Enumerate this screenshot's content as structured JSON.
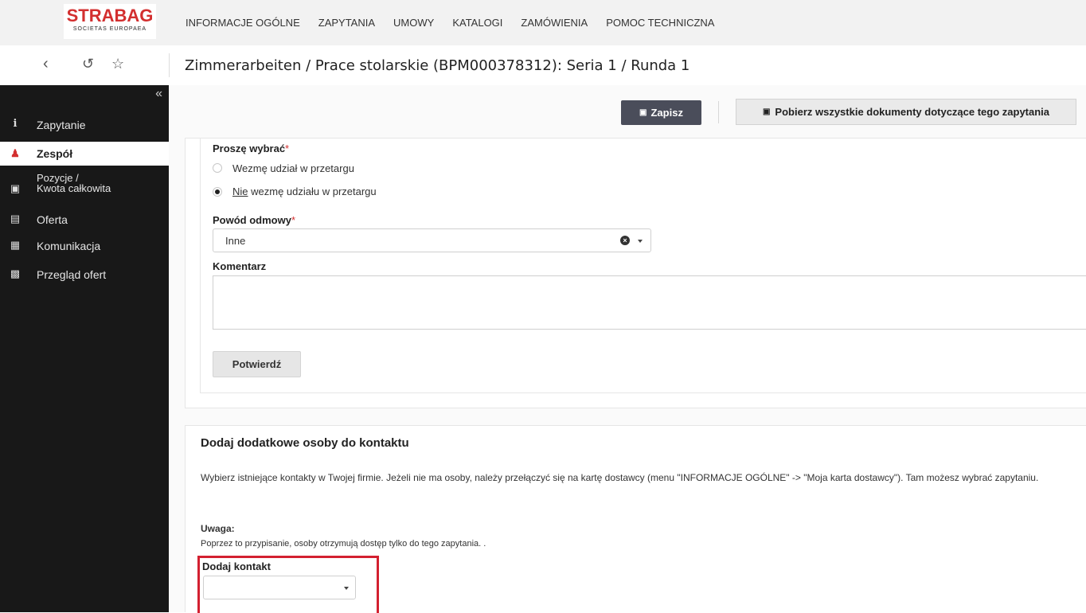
{
  "header": {
    "logo_main": "STRABAG",
    "logo_sub": "SOCIETAS EUROPAEA",
    "menu": [
      "INFORMACJE OGÓLNE",
      "ZAPYTANIA",
      "UMOWY",
      "KATALOGI",
      "ZAMÓWIENIA",
      "POMOC TECHNICZNA"
    ]
  },
  "page": {
    "title": "Zimmerarbeiten / Prace stolarskie (BPM000378312): Seria 1 / Runda 1"
  },
  "sidebar": {
    "items": [
      {
        "label": "Zapytanie",
        "icon": "info-icon"
      },
      {
        "label": "Zespół",
        "icon": "users-icon"
      },
      {
        "label": "Pozycje /",
        "label2": "Kwota całkowita",
        "icon": "package-icon"
      },
      {
        "label": "Oferta",
        "icon": "document-icon"
      },
      {
        "label": "Komunikacja",
        "icon": "newspaper-icon"
      },
      {
        "label": "Przegląd ofert",
        "icon": "archive-icon"
      }
    ]
  },
  "toolbar": {
    "save_label": "Zapisz",
    "download_label": "Pobierz wszystkie dokumenty dotyczące tego zapytania"
  },
  "form": {
    "choose_label": "Proszę wybrać",
    "required_mark": "*",
    "option1": "Wezmę udział w przetargu",
    "option2_underlined": "Nie",
    "option2_rest": " wezmę udziału w przetargu",
    "reason_label": "Powód odmowy",
    "reason_value": "Inne",
    "comment_label": "Komentarz",
    "confirm_label": "Potwierdź"
  },
  "contacts": {
    "heading": "Dodaj dodatkowe osoby do kontaktu",
    "description": "Wybierz istniejące kontakty w Twojej firmie. Jeżeli nie ma osoby, należy przełączyć się na kartę dostawcy (menu \"INFORMACJE OGÓLNE\" -> \"Moja karta dostawcy\"). Tam możesz wybrać zapytaniu.",
    "note_title": "Uwaga:",
    "note": "Poprzez to przypisanie, osoby otrzymują dostęp tylko do tego zapytania. .",
    "add_label": "Dodaj kontakt"
  },
  "colors": {
    "accent": "#d32f2f",
    "sidebar_bg": "#181818",
    "highlight": "#d32030",
    "save_bg": "#4a4d5a"
  }
}
